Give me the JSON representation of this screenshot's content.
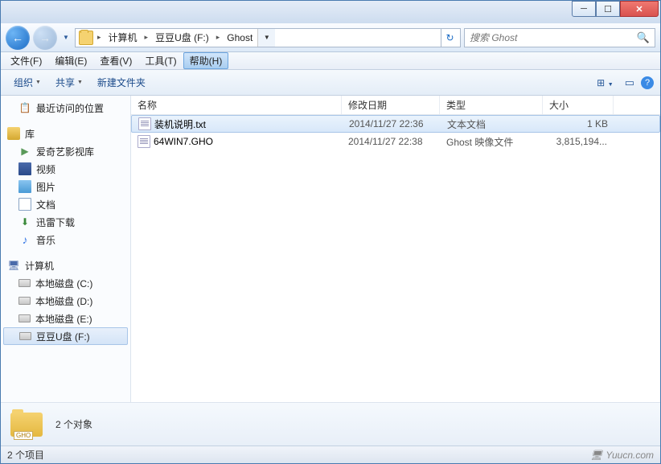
{
  "titlebar": {
    "min": "─",
    "max": "☐",
    "close": "✕"
  },
  "nav": {
    "back": "←",
    "fwd": "→",
    "dropdown": "▼",
    "refresh": "↻"
  },
  "breadcrumb": {
    "seg1": "计算机",
    "seg2": "豆豆U盘 (F:)",
    "seg3": "Ghost",
    "arrow": "▸",
    "end": "▼"
  },
  "search": {
    "placeholder": "搜索 Ghost",
    "icon": "🔍"
  },
  "menubar": {
    "file": "文件(F)",
    "edit": "编辑(E)",
    "view": "查看(V)",
    "tools": "工具(T)",
    "help": "帮助(H)"
  },
  "toolbar": {
    "org": "组织",
    "share": "共享",
    "new": "新建文件夹",
    "view": "⊞",
    "help": "?"
  },
  "sidebar": {
    "recent": "最近访问的位置",
    "lib": "库",
    "items": [
      "爱奇艺影视库",
      "视频",
      "图片",
      "文档",
      "迅雷下载",
      "音乐"
    ],
    "comp": "计算机",
    "drives": [
      "本地磁盘 (C:)",
      "本地磁盘 (D:)",
      "本地磁盘 (E:)",
      "豆豆U盘 (F:)"
    ]
  },
  "columns": {
    "name": "名称",
    "date": "修改日期",
    "type": "类型",
    "size": "大小"
  },
  "files": [
    {
      "name": "装机说明.txt",
      "date": "2014/11/27 22:36",
      "type": "文本文档",
      "size": "1 KB"
    },
    {
      "name": "64WIN7.GHO",
      "date": "2014/11/27 22:38",
      "type": "Ghost 映像文件",
      "size": "3,815,194..."
    }
  ],
  "details": {
    "count": "2 个对象",
    "gho": "GHO"
  },
  "statusbar": {
    "left": "2 个项目",
    "right": "Yuucn.com"
  }
}
